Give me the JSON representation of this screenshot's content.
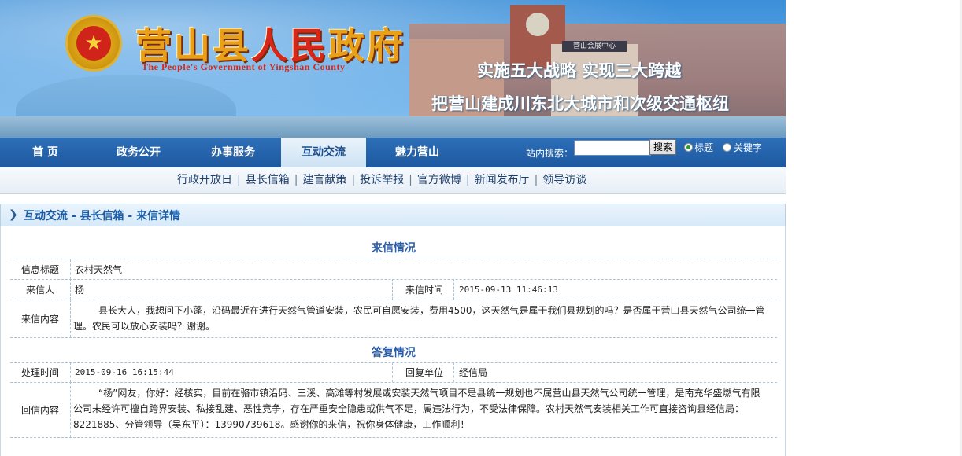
{
  "header": {
    "title_part1": "营山县",
    "title_part2": "人民",
    "title_part3": "政府",
    "title_en": "The People's Government of Yingshan County",
    "slogan_line1": "实施五大战略   实现三大跨越",
    "slogan_line2": "把营山建成川东北大城市和次级交通枢纽",
    "signboard": "营山会展中心",
    "emblem_glyph": "★"
  },
  "nav": {
    "items": [
      "首 页",
      "政务公开",
      "办事服务",
      "互动交流",
      "魅力营山"
    ],
    "active_index": 3,
    "search_label": "站内搜索：",
    "search_value": "",
    "search_button": "搜索",
    "radio_title": "标题",
    "radio_keyword": "关键字"
  },
  "subnav": {
    "links": [
      "行政开放日",
      "县长信箱",
      "建言献策",
      "投诉举报",
      "官方微博",
      "新闻发布厅",
      "领导访谈"
    ]
  },
  "breadcrumb": {
    "text": "互动交流 - 县长信箱 - 来信详情",
    "icon": "chevron-right-icon"
  },
  "letter": {
    "section_title": "来信情况",
    "title_label": "信息标题",
    "title_value": "农村天然气",
    "sender_label": "来信人",
    "sender_value": "杨",
    "time_label": "来信时间",
    "time_value": "2015-09-13 11:46:13",
    "content_label": "来信内容",
    "content_line1": "县长大人，我想问下小蓬，沿码最近在进行天然气管道安装，农民可自愿安装，费用4500，这天然气是属于我们县规划的吗？是否属于营山县天然气公司统一管",
    "content_line2": "理。农民可以放心安装吗？谢谢。"
  },
  "reply": {
    "section_title": "答复情况",
    "time_label": "处理时间",
    "time_value": "2015-09-16 16:15:44",
    "unit_label": "回复单位",
    "unit_value": "经信局",
    "content_label": "回信内容",
    "content_line1": "“杨”网友，你好：经核实，目前在骆市镇沿码、三溪、高滩等村发展或安装天然气项目不是县统一规划也不属营山县天然气公司统一管理，是南充华盛燃气有限",
    "content_line2": "公司未经许可擅自跨界安装、私接乱建、恶性竞争，存在严重安全隐患或供气不足，属违法行为，不受法律保障。农村天然气安装相关工作可直接咨询县经信局：",
    "content_line3": "8221885、分管领导（吴东平）：13990739618。感谢你的来信，祝你身体健康，工作顺利！"
  }
}
